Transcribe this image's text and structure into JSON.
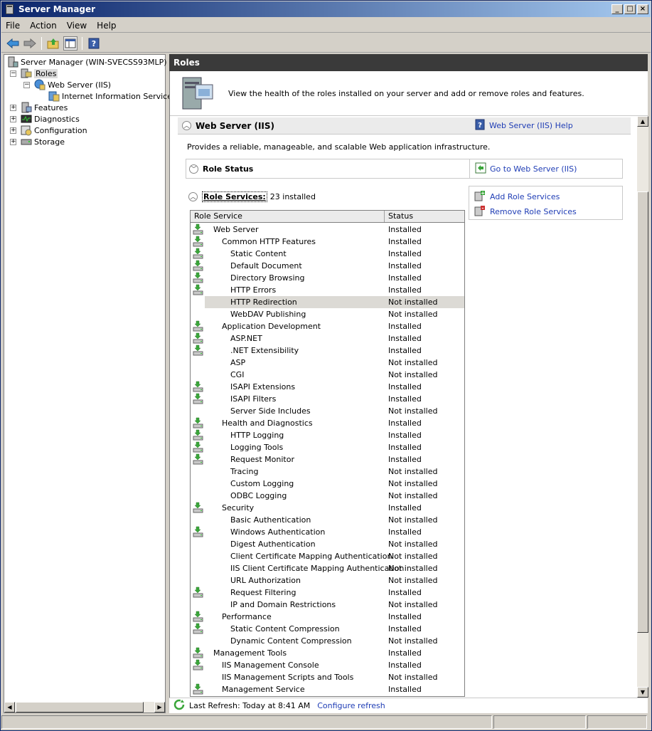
{
  "window": {
    "title": "Server Manager",
    "min_label": "_",
    "max_label": "□",
    "close_label": "×"
  },
  "menu": [
    "File",
    "Action",
    "View",
    "Help"
  ],
  "toolbar": {
    "back": "back-icon",
    "forward": "forward-icon",
    "up": "up-folder-icon",
    "showhide": "console-tree-icon",
    "help": "help-icon"
  },
  "tree": {
    "root": "Server Manager (WIN-SVECSS93MLP)",
    "roles": "Roles",
    "webserver": "Web Server (IIS)",
    "iis": "Internet Information Services",
    "features": "Features",
    "diagnostics": "Diagnostics",
    "configuration": "Configuration",
    "storage": "Storage"
  },
  "header": {
    "title": "Roles"
  },
  "intro": {
    "text": "View the health of the roles installed on your server and add or remove roles and features."
  },
  "section": {
    "title": "Web Server (IIS)",
    "help_link": "Web Server (IIS) Help",
    "description": "Provides a reliable, manageable, and scalable Web application infrastructure."
  },
  "role_status": {
    "title": "Role Status",
    "goto_link": "Go to Web Server (IIS)"
  },
  "role_services": {
    "title": "Role Services:",
    "count": "23 installed",
    "add_link": "Add Role Services",
    "remove_link": "Remove Role Services",
    "col_service": "Role Service",
    "col_status": "Status",
    "rows": [
      {
        "name": "Web Server",
        "level": 0,
        "status": "Installed",
        "icon": true
      },
      {
        "name": "Common HTTP Features",
        "level": 1,
        "status": "Installed",
        "icon": true
      },
      {
        "name": "Static Content",
        "level": 2,
        "status": "Installed",
        "icon": true
      },
      {
        "name": "Default Document",
        "level": 2,
        "status": "Installed",
        "icon": true
      },
      {
        "name": "Directory Browsing",
        "level": 2,
        "status": "Installed",
        "icon": true
      },
      {
        "name": "HTTP Errors",
        "level": 2,
        "status": "Installed",
        "icon": true
      },
      {
        "name": "HTTP Redirection",
        "level": 2,
        "status": "Not installed",
        "icon": false,
        "selected": true
      },
      {
        "name": "WebDAV Publishing",
        "level": 2,
        "status": "Not installed",
        "icon": false
      },
      {
        "name": "Application Development",
        "level": 1,
        "status": "Installed",
        "icon": true
      },
      {
        "name": "ASP.NET",
        "level": 2,
        "status": "Installed",
        "icon": true
      },
      {
        "name": ".NET Extensibility",
        "level": 2,
        "status": "Installed",
        "icon": true
      },
      {
        "name": "ASP",
        "level": 2,
        "status": "Not installed",
        "icon": false
      },
      {
        "name": "CGI",
        "level": 2,
        "status": "Not installed",
        "icon": false
      },
      {
        "name": "ISAPI Extensions",
        "level": 2,
        "status": "Installed",
        "icon": true
      },
      {
        "name": "ISAPI Filters",
        "level": 2,
        "status": "Installed",
        "icon": true
      },
      {
        "name": "Server Side Includes",
        "level": 2,
        "status": "Not installed",
        "icon": false
      },
      {
        "name": "Health and Diagnostics",
        "level": 1,
        "status": "Installed",
        "icon": true
      },
      {
        "name": "HTTP Logging",
        "level": 2,
        "status": "Installed",
        "icon": true
      },
      {
        "name": "Logging Tools",
        "level": 2,
        "status": "Installed",
        "icon": true
      },
      {
        "name": "Request Monitor",
        "level": 2,
        "status": "Installed",
        "icon": true
      },
      {
        "name": "Tracing",
        "level": 2,
        "status": "Not installed",
        "icon": false
      },
      {
        "name": "Custom Logging",
        "level": 2,
        "status": "Not installed",
        "icon": false
      },
      {
        "name": "ODBC Logging",
        "level": 2,
        "status": "Not installed",
        "icon": false
      },
      {
        "name": "Security",
        "level": 1,
        "status": "Installed",
        "icon": true
      },
      {
        "name": "Basic Authentication",
        "level": 2,
        "status": "Not installed",
        "icon": false
      },
      {
        "name": "Windows Authentication",
        "level": 2,
        "status": "Installed",
        "icon": true
      },
      {
        "name": "Digest Authentication",
        "level": 2,
        "status": "Not installed",
        "icon": false
      },
      {
        "name": "Client Certificate Mapping Authentication",
        "level": 2,
        "status": "Not installed",
        "icon": false
      },
      {
        "name": "IIS Client Certificate Mapping Authentication",
        "level": 2,
        "status": "Not installed",
        "icon": false
      },
      {
        "name": "URL Authorization",
        "level": 2,
        "status": "Not installed",
        "icon": false
      },
      {
        "name": "Request Filtering",
        "level": 2,
        "status": "Installed",
        "icon": true
      },
      {
        "name": "IP and Domain Restrictions",
        "level": 2,
        "status": "Not installed",
        "icon": false
      },
      {
        "name": "Performance",
        "level": 1,
        "status": "Installed",
        "icon": true
      },
      {
        "name": "Static Content Compression",
        "level": 2,
        "status": "Installed",
        "icon": true
      },
      {
        "name": "Dynamic Content Compression",
        "level": 2,
        "status": "Not installed",
        "icon": false
      },
      {
        "name": "Management Tools",
        "level": 0,
        "status": "Installed",
        "icon": true
      },
      {
        "name": "IIS Management Console",
        "level": 1,
        "status": "Installed",
        "icon": true
      },
      {
        "name": "IIS Management Scripts and Tools",
        "level": 1,
        "status": "Not installed",
        "icon": false
      },
      {
        "name": "Management Service",
        "level": 1,
        "status": "Installed",
        "icon": true
      }
    ]
  },
  "status": {
    "last_refresh": "Last Refresh: Today at 8:41 AM",
    "configure_link": "Configure refresh"
  },
  "colors": {
    "title_start": "#0a246a",
    "title_end": "#a6caf0",
    "link": "#1f3db5",
    "header_bg": "#3a3a3a",
    "installed_green": "#3aa63a"
  }
}
